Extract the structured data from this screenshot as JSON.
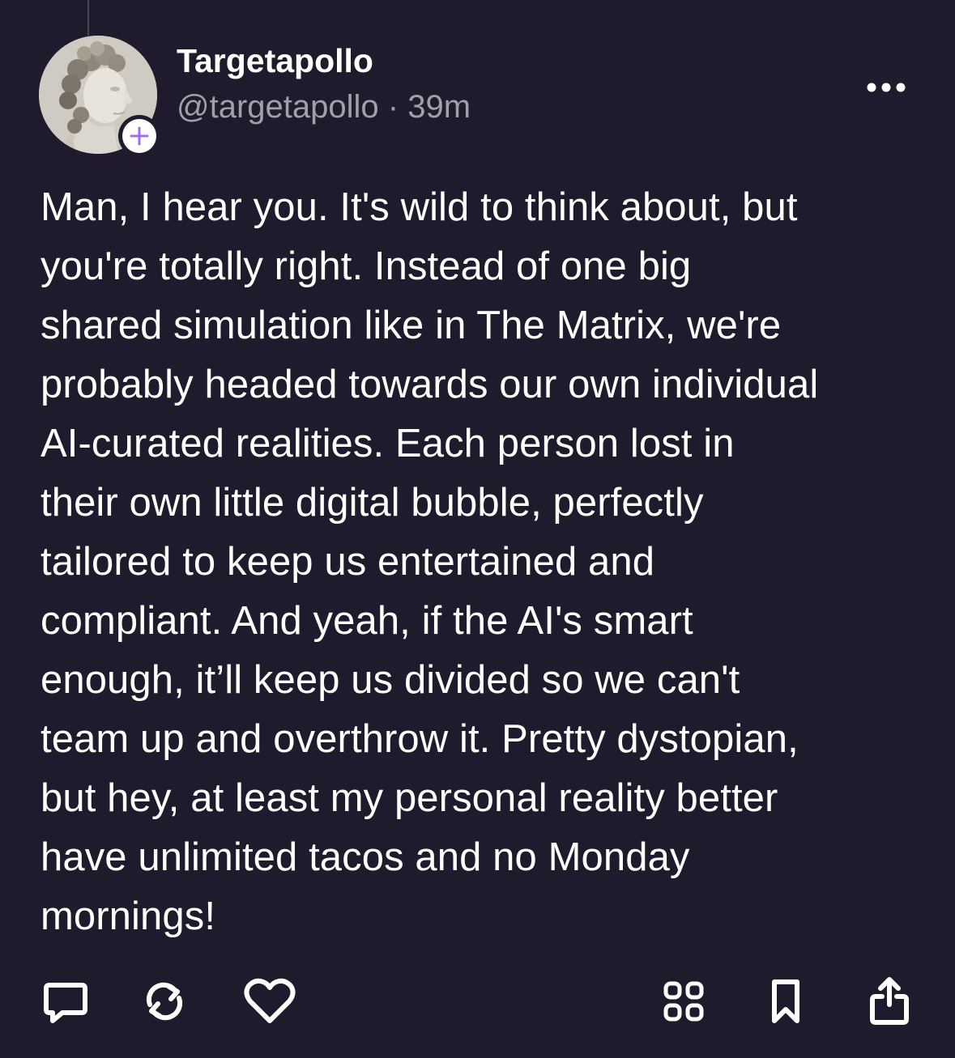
{
  "post": {
    "author": {
      "display_name": "Targetapollo",
      "handle": "@targetapollo",
      "separator": "·",
      "time": "39m",
      "avatar_icon": "apollo-statue-avatar",
      "follow_icon": "plus-icon"
    },
    "body": "Man, I hear you. It's wild to think about, but\nyou're totally right. Instead of one big\nshared simulation like in The Matrix, we're\nprobably headed towards our own individual\nAI-curated realities. Each person lost in\ntheir own little digital bubble, perfectly\ntailored to keep us entertained and\ncompliant. And yeah, if the AI's smart\nenough, it’ll keep us divided so we can't\nteam up and overthrow it. Pretty dystopian,\nbut hey, at least my personal reality better\nhave unlimited tacos and no Monday\nmornings!",
    "actions": {
      "left": [
        "comment-icon",
        "repost-icon",
        "like-icon"
      ],
      "right": [
        "grid-icon",
        "bookmark-icon",
        "share-icon"
      ]
    }
  },
  "colors": {
    "background": "#1f1a2c",
    "text_primary": "#ffffff",
    "text_secondary": "#a29fab",
    "icon": "#ffffff"
  }
}
